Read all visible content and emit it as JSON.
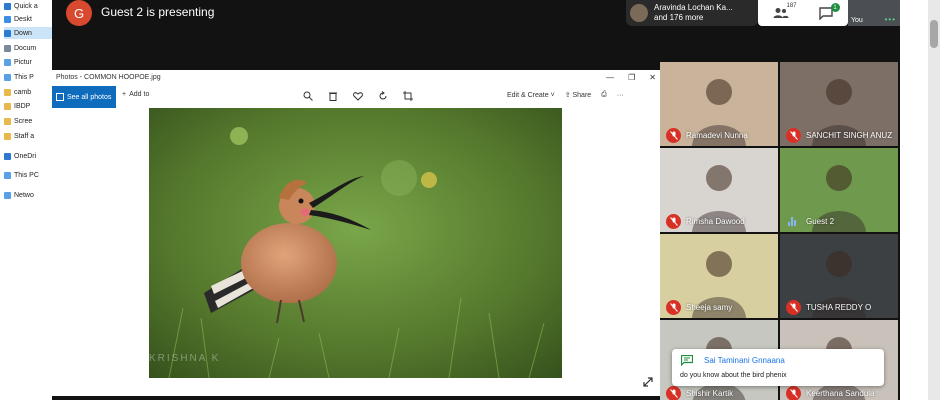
{
  "explorer": {
    "items": [
      {
        "label": "Quick a",
        "color": "#2b79d0"
      },
      {
        "label": "Deskt",
        "color": "#3a8ee6"
      },
      {
        "label": "Down",
        "color": "#2b79d0"
      },
      {
        "label": "Docum",
        "color": "#7a8a9a"
      },
      {
        "label": "Pictur",
        "color": "#5aa0e6"
      },
      {
        "label": "This P",
        "color": "#5aa0e6"
      },
      {
        "label": "camb",
        "color": "#e8b84a"
      },
      {
        "label": "IBDP",
        "color": "#e8b84a"
      },
      {
        "label": "Scree",
        "color": "#e8b84a"
      },
      {
        "label": "Staff a",
        "color": "#e8b84a"
      },
      {
        "label": "OneDri",
        "color": "#2b79d0"
      },
      {
        "label": "This PC",
        "color": "#5aa0e6"
      },
      {
        "label": "Netwo",
        "color": "#5aa0e6"
      }
    ]
  },
  "meet": {
    "presenter_initial": "G",
    "presenting_text": "Guest 2 is presenting",
    "people_line1": "Aravinda Lochan Ka...",
    "people_line2": "and 176 more",
    "people_count": "187",
    "chat_badge": "1",
    "self_label": "You",
    "self_dots": "•••"
  },
  "photos": {
    "title": "Photos - COMMON HOOPOE.jpg",
    "see_all": "See all photos",
    "add_to": "Add to",
    "edit_create": "Edit & Create",
    "share": "Share",
    "watermark": "KRISHNA K",
    "icons": [
      "zoom-icon",
      "delete-icon",
      "favorite-icon",
      "rotate-icon",
      "crop-icon"
    ]
  },
  "participants": [
    {
      "name": "Ramadevi Nunna",
      "mic": "off",
      "bg": "#c9b39a"
    },
    {
      "name": "SANCHIT SINGH ANUZ",
      "mic": "off",
      "bg": "#7d6f66"
    },
    {
      "name": "Rimsha Dawood",
      "mic": "off",
      "bg": "#d8d4cf"
    },
    {
      "name": "Guest 2",
      "mic": "on",
      "bg": "#6f9a4e"
    },
    {
      "name": "Sheeja samy",
      "mic": "off",
      "bg": "#d8cfa0"
    },
    {
      "name": "TUSHA REDDY O",
      "mic": "off",
      "bg": "#3c4043"
    },
    {
      "name": "Shishir Kartik",
      "mic": "off",
      "bg": "#c5c7c0"
    },
    {
      "name": "Keerthana Sandula",
      "mic": "off",
      "bg": "#c9c2bb"
    }
  ],
  "toast": {
    "sender": "Sai Taminani Gnnaana",
    "message": "do you know about the bird phenix"
  },
  "colors": {
    "meet_bg": "#121212",
    "mic_off": "#d93025",
    "accent_blue": "#0f6cbd",
    "chat_blue": "#1a73e8"
  }
}
